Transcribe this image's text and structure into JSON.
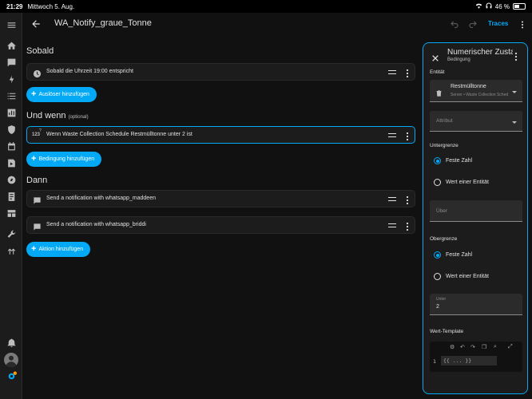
{
  "statusbar": {
    "time": "21:29",
    "date": "Mittwoch 5. Aug.",
    "battery": "46 %"
  },
  "header": {
    "title": "WA_Notify_graue_Tonne",
    "traces_label": "Traces"
  },
  "sections": {
    "triggers_title": "Sobald",
    "conditions_title": "Und wenn",
    "conditions_optional": "(optional)",
    "actions_title": "Dann"
  },
  "triggers": [
    {
      "label": "Sobald die Uhrzeit 19:00 entspricht",
      "icon": "clock-icon"
    }
  ],
  "conditions": [
    {
      "label": "Wenn Waste Collection Schedule Restmülltonne unter 2 ist",
      "icon": "numeric-icon",
      "icon_text": "123"
    }
  ],
  "actions": [
    {
      "label": "Send a notification with whatsapp_maddeen",
      "icon": "message-icon"
    },
    {
      "label": "Send a notification with whatsapp_briddi",
      "icon": "message-icon"
    }
  ],
  "buttons": {
    "add_trigger": "Auslöser hinzufügen",
    "add_condition": "Bedingung hinzufügen",
    "add_action": "Aktion hinzufügen"
  },
  "panel": {
    "title": "Numerischer Zustand",
    "subtitle": "Bedingung",
    "entity_label": "Entität",
    "entity_name": "Restmülltonne",
    "entity_sub": "Server • Waste Collection Schedule",
    "attribute_placeholder": "Attribut",
    "lower_label": "Untergrenze",
    "lower_options": [
      "Feste Zahl",
      "Wert einer Entität"
    ],
    "above_placeholder": "Über",
    "upper_label": "Obergrenze",
    "upper_options": [
      "Feste Zahl",
      "Wert einer Entität"
    ],
    "below_label": "Unter",
    "below_value": "2",
    "template_label": "Wert-Template",
    "template_line": "1",
    "template_code": "{{ ... }}"
  },
  "colors": {
    "accent": "#03a9f4",
    "background": "#111111",
    "card": "#1c1c1c"
  }
}
